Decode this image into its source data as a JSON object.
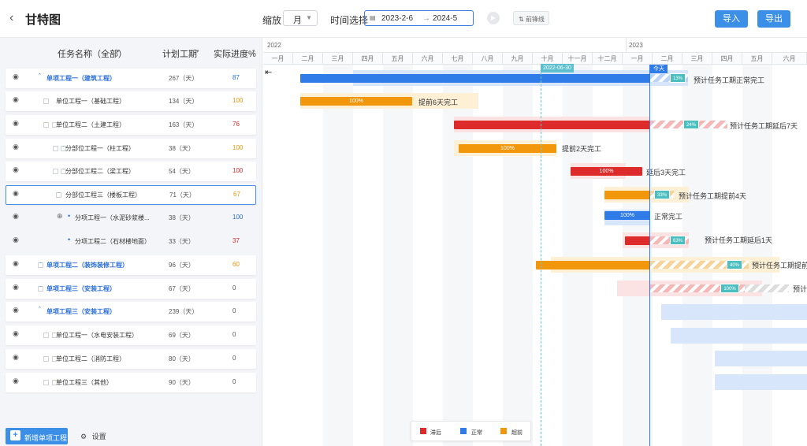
{
  "header": {
    "back_icon": "chevron-left-icon",
    "title": "甘特图",
    "zoom_label": "缩放",
    "zoom_value": "月",
    "time_label": "时间选择",
    "date_start": "2023-2-6",
    "date_arrow": "→",
    "date_end": "2024-5",
    "play_icon": "play-icon",
    "frontline_label": "前锋线",
    "import_label": "导入",
    "export_label": "导出"
  },
  "table": {
    "col_name": "任务名称（全部）",
    "col_duration": "计划工期",
    "col_progress": "实际进度%",
    "rows": [
      {
        "name": "单项工程一（建筑工程）",
        "duration": "267（天）",
        "progress": "87"
      },
      {
        "name": "单位工程一（基础工程）",
        "duration": "134（天）",
        "progress": "100"
      },
      {
        "name": "单位工程二（土建工程）",
        "duration": "163（天）",
        "progress": "76"
      },
      {
        "name": "分部位工程一（柱工程）",
        "duration": "38（天）",
        "progress": "100"
      },
      {
        "name": "分部位工程二（梁工程）",
        "duration": "54（天）",
        "progress": "100"
      },
      {
        "name": "分部位工程三（楼板工程）",
        "duration": "71（天）",
        "progress": "67"
      },
      {
        "name": "分项工程一（水泥砂浆楼...",
        "duration": "38（天）",
        "progress": "100"
      },
      {
        "name": "分项工程二（石材楼地面）",
        "duration": "33（天）",
        "progress": "37"
      },
      {
        "name": "单项工程二（装饰装修工程）",
        "duration": "96（天）",
        "progress": "60"
      },
      {
        "name": "单项工程三（安装工程）",
        "duration": "67（天）",
        "progress": "0"
      },
      {
        "name": "单项工程三（安装工程）",
        "duration": "239（天）",
        "progress": "0"
      },
      {
        "name": "单位工程一（水电安装工程）",
        "duration": "69（天）",
        "progress": "0"
      },
      {
        "name": "单位工程二（消防工程）",
        "duration": "80（天）",
        "progress": "0"
      },
      {
        "name": "单位工程三（其他）",
        "duration": "90（天）",
        "progress": "0"
      }
    ]
  },
  "footer": {
    "add_label": "新增单项工程",
    "settings_label": "设置"
  },
  "timeline": {
    "year_2022": "2022",
    "year_2023": "2023",
    "months": [
      "一月",
      "二月",
      "三月",
      "四月",
      "五月",
      "六月",
      "七月",
      "八月",
      "九月",
      "十月",
      "十一月",
      "十二月",
      "一月",
      "二月",
      "三月",
      "四月",
      "五月",
      "六月"
    ],
    "baseline_label": "2022-06-30",
    "today_label": "今天"
  },
  "bars": {
    "b1_badge": "13%",
    "b1_note": "预计任务工期正常完工",
    "b2_label": "100%",
    "b2_note": "提前6天完工",
    "b3_badge": "24%",
    "b3_note": "预计任务工期延后7天",
    "b4_label": "100%",
    "b4_note": "提前2天完工",
    "b5_label": "100%",
    "b5_note": "延后3天完工",
    "b6_badge": "33%",
    "b6_note": "预计任务工期提前4天",
    "b7_label": "100%",
    "b7_note": "正常完工",
    "b8_badge": "63%",
    "b8_note": "预计任务工期延后1天",
    "b9_badge": "40%",
    "b9_note": "预计任务工期提前",
    "b10_badge": "100%",
    "b10_note": "预计"
  },
  "legend": {
    "delayed": "滞后",
    "normal": "正常",
    "ahead": "超前"
  },
  "colors": {
    "normal": "#2f7be8",
    "delayed": "#dd2a2a",
    "ahead": "#f2960c"
  }
}
